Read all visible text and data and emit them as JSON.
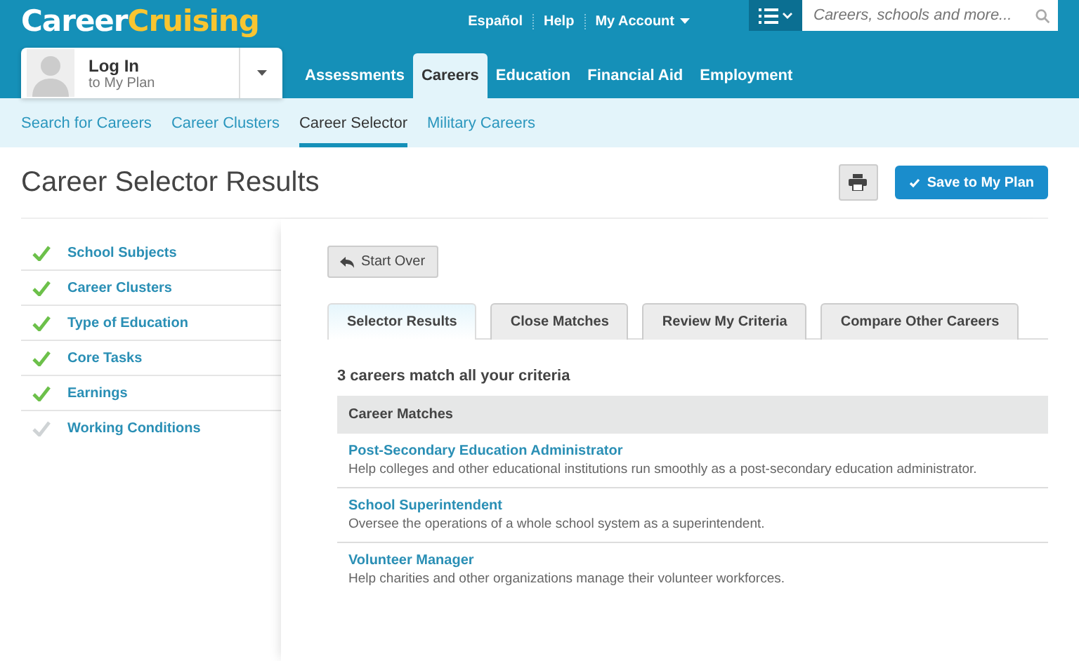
{
  "logo": {
    "first": "Career",
    "second": "Cruising"
  },
  "top_links": [
    {
      "label": "Español",
      "dropdown": false
    },
    {
      "label": "Help",
      "dropdown": false
    },
    {
      "label": "My Account",
      "dropdown": true
    }
  ],
  "search": {
    "placeholder": "Careers, schools and more..."
  },
  "login": {
    "title": "Log In",
    "subtitle": "to My Plan"
  },
  "main_nav": [
    {
      "label": "Assessments",
      "selected": false
    },
    {
      "label": "Careers",
      "selected": true
    },
    {
      "label": "Education",
      "selected": false
    },
    {
      "label": "Financial Aid",
      "selected": false
    },
    {
      "label": "Employment",
      "selected": false
    }
  ],
  "sub_nav": [
    {
      "label": "Search for Careers",
      "selected": false
    },
    {
      "label": "Career Clusters",
      "selected": false
    },
    {
      "label": "Career Selector",
      "selected": true
    },
    {
      "label": "Military Careers",
      "selected": false
    }
  ],
  "page_title": "Career Selector Results",
  "save_button": "Save to My Plan",
  "criteria": [
    {
      "label": "School Subjects",
      "done": true
    },
    {
      "label": "Career Clusters",
      "done": true
    },
    {
      "label": "Type of Education",
      "done": true
    },
    {
      "label": "Core Tasks",
      "done": true
    },
    {
      "label": "Earnings",
      "done": true
    },
    {
      "label": "Working Conditions",
      "done": false
    }
  ],
  "start_over": "Start Over",
  "tabs": [
    {
      "label": "Selector Results",
      "selected": true
    },
    {
      "label": "Close Matches",
      "selected": false
    },
    {
      "label": "Review My Criteria",
      "selected": false
    },
    {
      "label": "Compare Other Careers",
      "selected": false
    }
  ],
  "summary": "3 careers match all your criteria",
  "table": {
    "header": "Career Matches",
    "rows": [
      {
        "title": "Post-Secondary Education Administrator",
        "description": "Help colleges and other educational institutions run smoothly as a post-secondary education administrator."
      },
      {
        "title": "School Superintendent",
        "description": "Oversee the operations of a whole school system as a superintendent."
      },
      {
        "title": "Volunteer Manager",
        "description": "Help charities and other organizations manage their volunteer workforces."
      }
    ]
  }
}
